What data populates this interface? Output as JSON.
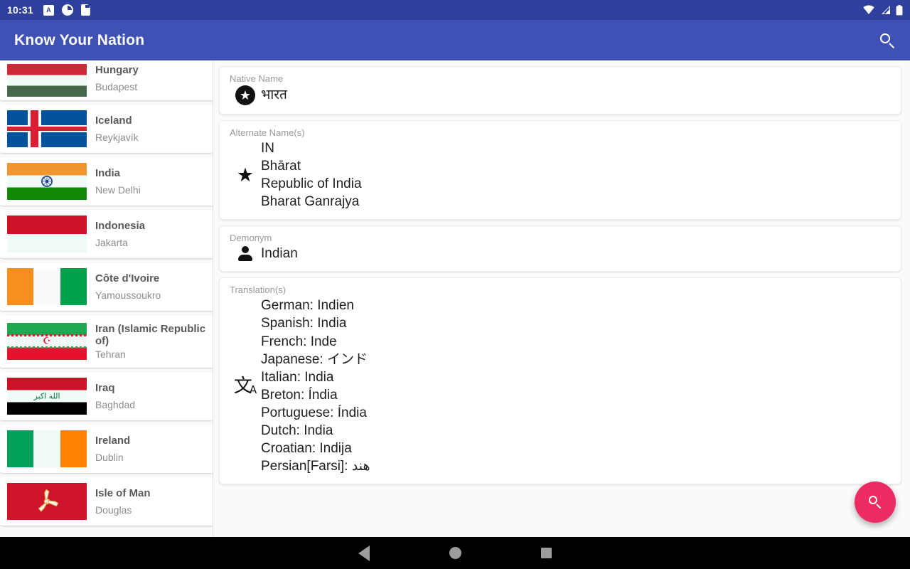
{
  "statusbar": {
    "clock": "10:31",
    "left_icons": [
      "letter-a-badge-icon",
      "pie-clock-icon",
      "sd-card-icon"
    ],
    "right_icons": [
      "wifi-icon",
      "cell-signal-icon",
      "battery-icon"
    ],
    "background": "#2f3f9e"
  },
  "appbar": {
    "title": "Know Your Nation",
    "search_icon": "search-icon",
    "background": "#3f51b5",
    "text_color": "#ffffff"
  },
  "list": {
    "items": [
      {
        "name": "Hungary",
        "capital": "Budapest",
        "flag": "hungary",
        "clipped_top": true
      },
      {
        "name": "Iceland",
        "capital": "Reykjavík",
        "flag": "iceland"
      },
      {
        "name": "India",
        "capital": "New Delhi",
        "flag": "india",
        "selected": true
      },
      {
        "name": "Indonesia",
        "capital": "Jakarta",
        "flag": "indonesia"
      },
      {
        "name": "Côte d'Ivoire",
        "capital": "Yamoussoukro",
        "flag": "ivory-coast"
      },
      {
        "name": "Iran (Islamic Republic of)",
        "capital": "Tehran",
        "flag": "iran",
        "two_line": true
      },
      {
        "name": "Iraq",
        "capital": "Baghdad",
        "flag": "iraq"
      },
      {
        "name": "Ireland",
        "capital": "Dublin",
        "flag": "ireland"
      },
      {
        "name": "Isle of Man",
        "capital": "Douglas",
        "flag": "isle-of-man"
      }
    ]
  },
  "detail": {
    "native_name": {
      "label": "Native Name",
      "icon": "star-circle-icon",
      "value": "भारत"
    },
    "alternate_names": {
      "label": "Alternate Name(s)",
      "icon": "star-icon",
      "value": "IN\nBhārat\nRepublic of India\nBharat Ganrajya"
    },
    "demonym": {
      "label": "Demonym",
      "icon": "person-icon",
      "value": "Indian"
    },
    "translations": {
      "label": "Translation(s)",
      "icon": "translate-icon",
      "value": "German: Indien\nSpanish: India\nFrench: Inde\nJapanese: インド\nItalian: India\nBreton: Índia\nPortuguese: Índia\nDutch: India\nCroatian: Indija\nPersian[Farsi]: هند"
    }
  },
  "fab": {
    "icon": "search-icon",
    "color": "#ec2b63"
  },
  "navbar": {
    "back": "back-triangle-icon",
    "home": "home-circle-icon",
    "recents": "recents-square-icon",
    "background": "#000000"
  }
}
